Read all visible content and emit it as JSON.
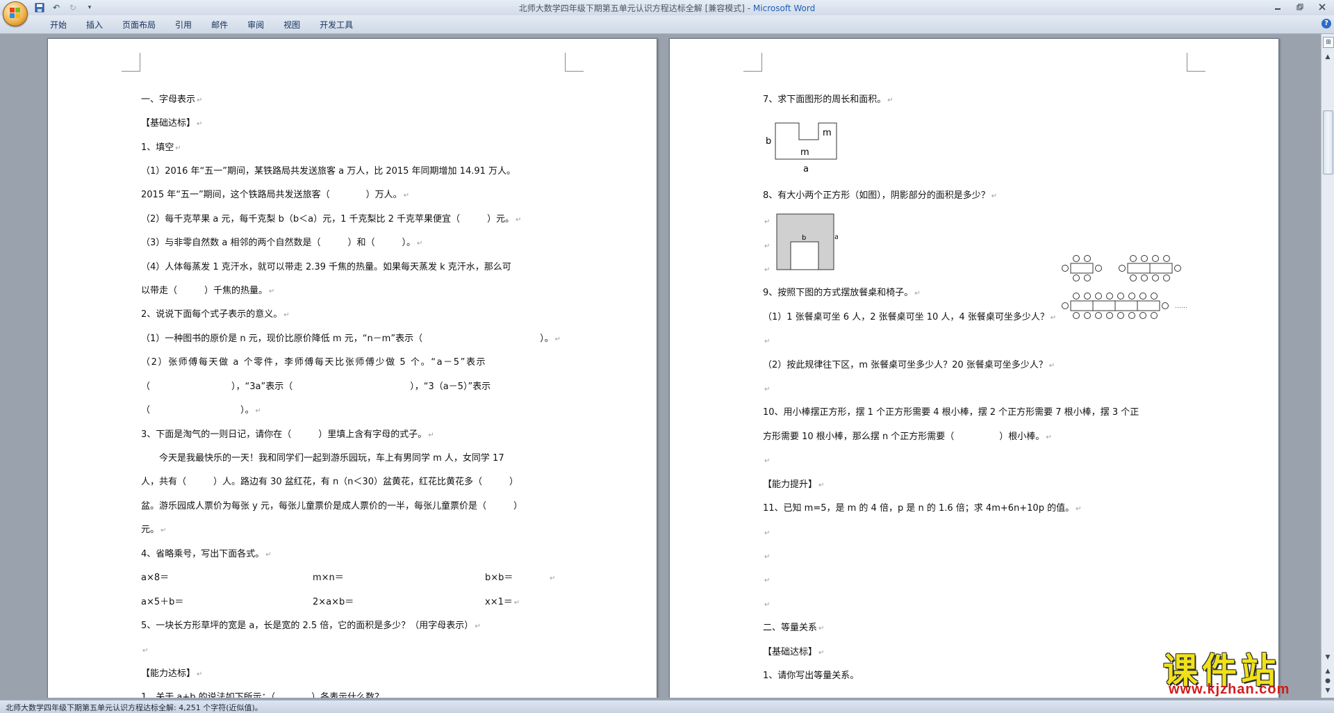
{
  "titlebar": {
    "doc_name": "北师大数学四年级下期第五单元认识方程达标全解 [兼容模式] - ",
    "app_name": "Microsoft Word",
    "dropdown": "▾"
  },
  "ribbon": {
    "tabs": [
      "开始",
      "插入",
      "页面布局",
      "引用",
      "邮件",
      "审阅",
      "视图",
      "开发工具"
    ]
  },
  "para_mark": "↵",
  "left_page": {
    "lines": [
      "一、字母表示",
      "【基础达标】",
      "1、填空",
      "（1）2016 年“五一”期间，某铁路局共发送旅客 a 万人，比 2015 年同期增加 14.91 万人。",
      "2015 年“五一”期间，这个铁路局共发送旅客（　　　　）万人。",
      "（2）每千克苹果 a 元，每千克梨 b（b＜a）元，1 千克梨比 2 千克苹果便宜（　　　）元。",
      "（3）与非零自然数 a 相邻的两个自然数是（　　　）和（　　　）。",
      "（4）人体每蒸发 1 克汗水，就可以带走 2.39 千焦的热量。如果每天蒸发 k 克汗水，那么可",
      "以带走（　　　）千焦的热量。",
      "2、说说下面每个式子表示的意义。",
      "（1）一种图书的原价是 n 元，现价比原价降低 m 元，“n－m”表示（　　　　　　　　　　　　　）。",
      "（2）张师傅每天做 a 个零件，李师傅每天比张师傅少做 5 个。“a－5”表示",
      "（　　　　　　　　　），“3a”表示（　　　　　　　　　　　　　），“3（a－5）”表示",
      "（　　　　　　　　　　）。",
      "3、下面是淘气的一则日记，请你在（　　　）里填上含有字母的式子。",
      "　　今天是我最快乐的一天！我和同学们一起到游乐园玩，车上有男同学 m 人，女同学 17",
      "人，共有（　　　）人。路边有 30 盆红花，有 n（n＜30）盆黄花，红花比黄花多（　　　）",
      "盆。游乐园成人票价为每张 y 元，每张儿童票价是成人票价的一半，每张儿童票价是（　　　）",
      "元。",
      "4、省略乘号，写出下面各式。",
      "a×8＝",
      "m×n＝",
      "b×b＝",
      "a×5＋b＝",
      "2×a×b＝",
      "x×1＝",
      "5、一块长方形草坪的宽是 a，长是宽的 2.5 倍，它的面积是多少？（用字母表示）",
      "",
      "【能力达标】",
      "1、关于 a+b 的说法如下所示：（　　　　）各表示什么数？"
    ]
  },
  "right_page": {
    "lines": [
      "7、求下面图形的周长和面积。",
      "8、有大小两个正方形（如图），阴影部分的面积是多少？",
      "9、按照下图的方式摆放餐桌和椅子。",
      "（1）1 张餐桌可坐 6 人，2 张餐桌可坐 10 人，4 张餐桌可坐多少人？",
      "（2）按此规律往下区，m 张餐桌可坐多少人？20 张餐桌可坐多少人？",
      "10、用小棒摆正方形，摆 1 个正方形需要 4 根小棒，摆 2 个正方形需要 7 根小棒，摆 3 个正",
      "方形需要 10 根小棒，那么摆 n 个正方形需要（　　　　　）根小棒。",
      "【能力提升】",
      "11、已知 m=5，是 m 的 4 倍，p 是 n 的 1.6 倍；求 4m+6n+10p 的值。",
      "二、等量关系",
      "【基础达标】",
      "1、请你写出等量关系。"
    ],
    "fig7": {
      "b": "b",
      "m_top": "m",
      "m_inner": "m",
      "a": "a"
    },
    "fig8": {
      "b": "b",
      "a": "a"
    },
    "fig9": {
      "ellipsis": "……"
    }
  },
  "statusbar": {
    "text": "北师大数学四年级下期第五单元认识方程达标全解: 4,251 个字符(近似值)。"
  },
  "watermark": {
    "title": "课件站",
    "url": "www.kjzhan.com"
  }
}
